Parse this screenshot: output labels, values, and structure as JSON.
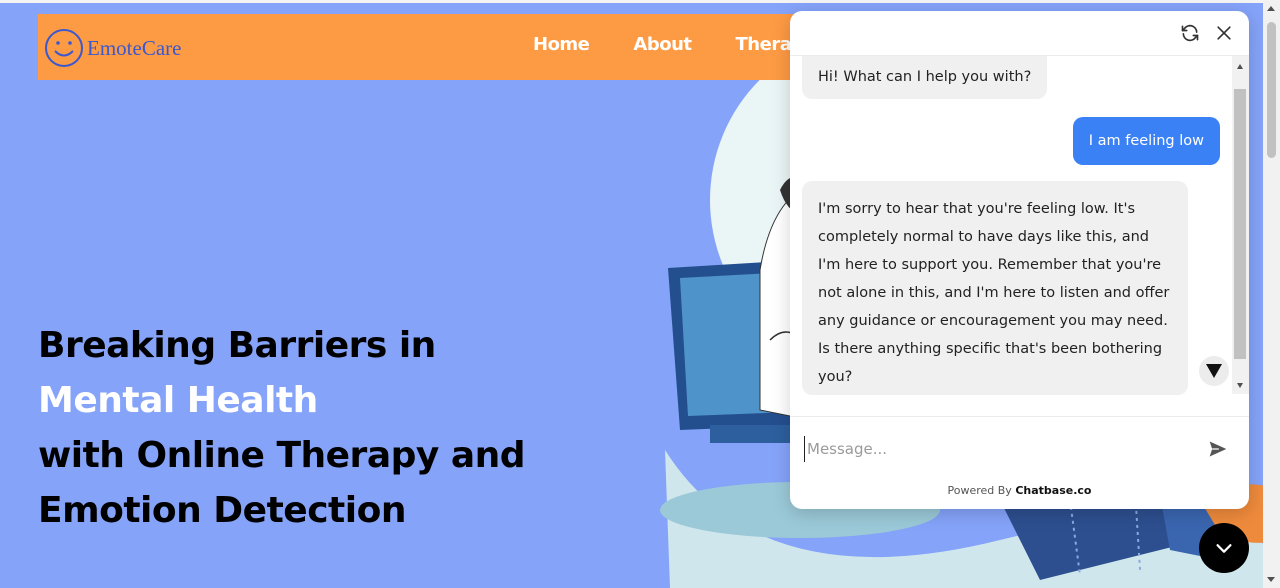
{
  "nav": {
    "logo_text": "EmoteCare",
    "links": [
      "Home",
      "About",
      "Therap"
    ]
  },
  "hero": {
    "line1": "Breaking Barriers in",
    "line2": "Mental Health",
    "line3": "with Online Therapy and",
    "line4": "Emotion Detection"
  },
  "chat": {
    "header_icons": [
      "refresh-icon",
      "close-icon"
    ],
    "messages": [
      {
        "role": "bot",
        "text": "Hi! What can I help you with?"
      },
      {
        "role": "user",
        "text": "I am feeling low"
      },
      {
        "role": "bot",
        "text": "I'm sorry to hear that you're feeling low. It's completely normal to have days like this, and I'm here to support you. Remember that you're not alone in this, and I'm here to listen and offer any guidance or encouragement you may need. Is there anything specific that's been bothering you?"
      }
    ],
    "input_placeholder": "Message...",
    "powered_by_prefix": "Powered By",
    "powered_by_brand": "Chatbase.co"
  },
  "colors": {
    "page_bg": "#85a3f9",
    "navbar_bg": "#fd9a44",
    "user_bubble": "#3b81f6",
    "bot_bubble": "#f0f0f0",
    "logo_text": "#3b58cf"
  }
}
